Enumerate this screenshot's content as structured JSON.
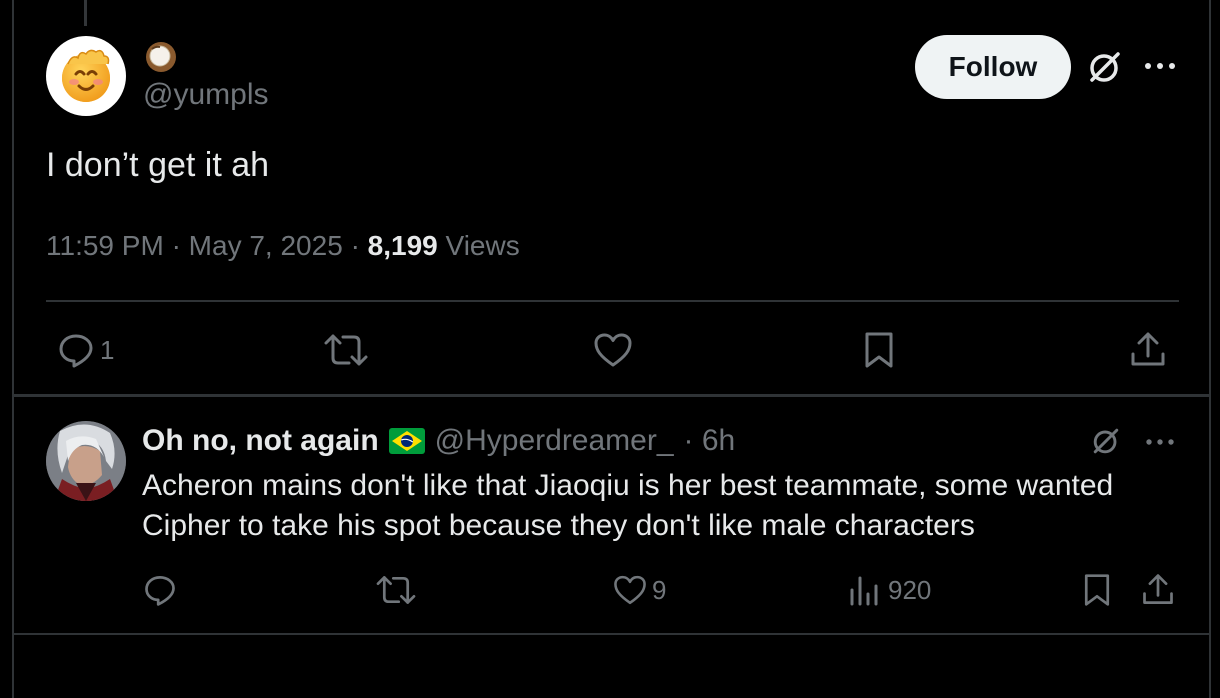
{
  "main_tweet": {
    "display_name_emoji": "coconut-emoji",
    "handle": "@yumpls",
    "follow_label": "Follow",
    "text": "I don’t get it ah",
    "time": "11:59 PM",
    "date": "May 7, 2025",
    "separator": "·",
    "views_count": "8,199",
    "views_label": "Views",
    "actions": {
      "reply_count": "1",
      "repost_count": "",
      "like_count": "",
      "bookmark_count": ""
    }
  },
  "reply": {
    "display_name": "Oh no, not again",
    "flag": "brazil-flag",
    "handle": "@Hyperdreamer_",
    "time": "· 6h",
    "text": "Acheron mains don't like that Jiaoqiu is her best teammate, some wanted Cipher to take his spot because they don't like male characters",
    "actions": {
      "reply_count": "",
      "repost_count": "",
      "like_count": "9",
      "views_count": "920"
    }
  },
  "colors": {
    "background": "#000000",
    "text_primary": "#e7e9ea",
    "text_secondary": "#71767b",
    "border": "#2f3336",
    "follow_bg": "#eff3f4"
  }
}
